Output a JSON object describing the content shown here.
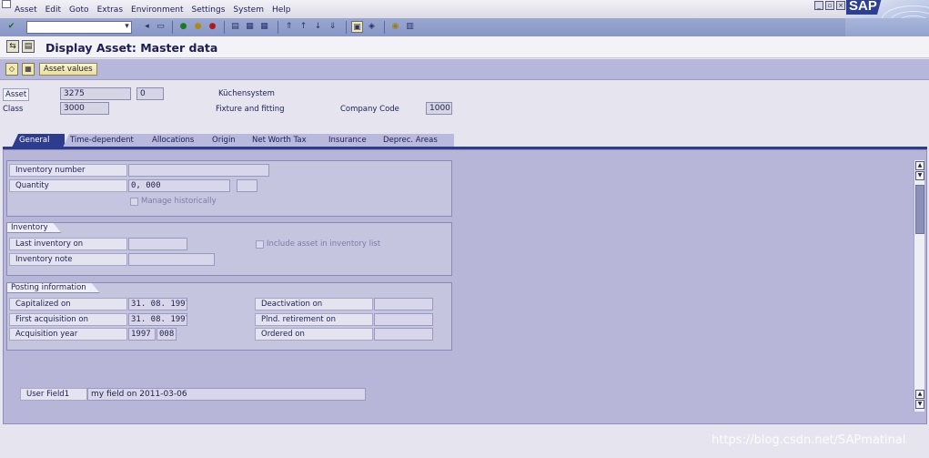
{
  "menu": {
    "items": [
      "Asset",
      "Edit",
      "Goto",
      "Extras",
      "Environment",
      "Settings",
      "System",
      "Help"
    ]
  },
  "window_controls": [
    "minimize",
    "maximize",
    "close"
  ],
  "logo_text": "SAP",
  "toolbar": {
    "command_field_value": "",
    "icons": [
      "enter-check-icon",
      "dropdown-icon",
      "save-icon",
      "back-icon",
      "exit-icon",
      "cancel-icon",
      "print-icon",
      "find-icon",
      "find-next-icon",
      "first-page-icon",
      "previous-page-icon",
      "next-page-icon",
      "last-page-icon",
      "new-session-icon",
      "shortcut-icon",
      "help-icon",
      "layout-icon"
    ]
  },
  "title": {
    "text": "Display Asset: Master data"
  },
  "app_toolbar": {
    "asset_values_label": "Asset values"
  },
  "header": {
    "asset_label": "Asset",
    "asset_number": "3275",
    "asset_subnumber": "0",
    "asset_description": "Küchensystem",
    "class_label": "Class",
    "class_value": "3000",
    "class_description": "Fixture and fitting",
    "company_code_label": "Company Code",
    "company_code_value": "1000"
  },
  "tabs": [
    {
      "label": "General",
      "active": true
    },
    {
      "label": "Time-dependent",
      "active": false
    },
    {
      "label": "Allocations",
      "active": false
    },
    {
      "label": "Origin",
      "active": false
    },
    {
      "label": "Net Worth Tax",
      "active": false
    },
    {
      "label": "Insurance",
      "active": false
    },
    {
      "label": "Deprec. Areas",
      "active": false
    }
  ],
  "general": {
    "inventory_number_label": "Inventory number",
    "inventory_number_value": "",
    "quantity_label": "Quantity",
    "quantity_value": "0, 000",
    "quantity_unit": "",
    "manage_historically_label": "Manage historically",
    "manage_historically_checked": false
  },
  "inventory": {
    "title": "Inventory",
    "last_inventory_label": "Last inventory on",
    "last_inventory_value": "",
    "include_in_list_label": "Include asset in inventory list",
    "include_in_list_checked": false,
    "inventory_note_label": "Inventory note",
    "inventory_note_value": ""
  },
  "posting": {
    "title": "Posting information",
    "capitalized_label": "Capitalized on",
    "capitalized_value": "31. 08. 1997",
    "first_acquisition_label": "First acquisition on",
    "first_acquisition_value": "31. 08. 1997",
    "acquisition_year_label": "Acquisition year",
    "acquisition_year_value": "1997",
    "acquisition_period_value": "008",
    "deactivation_label": "Deactivation on",
    "deactivation_value": "",
    "planned_retirement_label": "Plnd. retirement on",
    "planned_retirement_value": "",
    "ordered_label": "Ordered on",
    "ordered_value": ""
  },
  "user_field": {
    "label": "User Field1",
    "value": "my field on 2011-03-06"
  },
  "watermark": "https://blog.csdn.net/SAPmatinal",
  "colors": {
    "toolbar_blue": "#8796c5",
    "active_tab": "#2d3c8d",
    "panel": "#b7b6d8",
    "app_toolbar": "#b6b7db"
  }
}
